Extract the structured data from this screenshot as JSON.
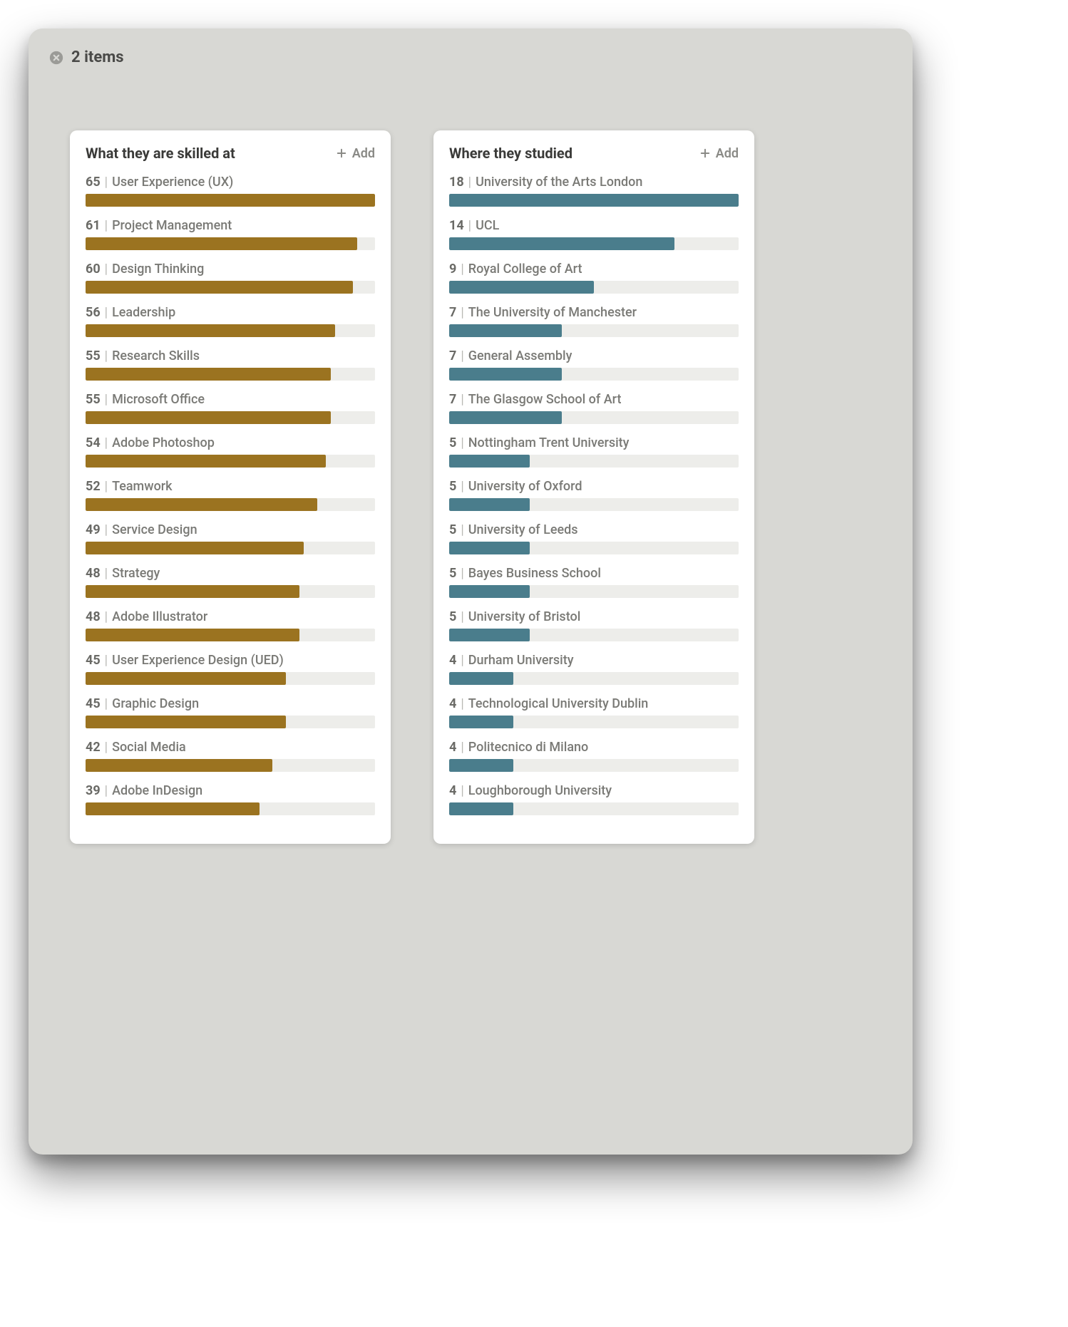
{
  "header": {
    "title": "2 items"
  },
  "buttons": {
    "add_label": "Add"
  },
  "colors": {
    "skills_fill": "#9b7320",
    "studied_fill": "#4a7d8c",
    "track": "#ededea"
  },
  "cards": [
    {
      "id": "skills",
      "title": "What they are skilled at",
      "fill_color": "#9b7320",
      "max_value": 65,
      "items": [
        {
          "value": 65,
          "label": "User Experience (UX)"
        },
        {
          "value": 61,
          "label": "Project Management"
        },
        {
          "value": 60,
          "label": "Design Thinking"
        },
        {
          "value": 56,
          "label": "Leadership"
        },
        {
          "value": 55,
          "label": "Research Skills"
        },
        {
          "value": 55,
          "label": "Microsoft Office"
        },
        {
          "value": 54,
          "label": "Adobe Photoshop"
        },
        {
          "value": 52,
          "label": "Teamwork"
        },
        {
          "value": 49,
          "label": "Service Design"
        },
        {
          "value": 48,
          "label": "Strategy"
        },
        {
          "value": 48,
          "label": "Adobe Illustrator"
        },
        {
          "value": 45,
          "label": "User Experience Design (UED)"
        },
        {
          "value": 45,
          "label": "Graphic Design"
        },
        {
          "value": 42,
          "label": "Social Media"
        },
        {
          "value": 39,
          "label": "Adobe InDesign"
        }
      ]
    },
    {
      "id": "studied",
      "title": "Where they studied",
      "fill_color": "#4a7d8c",
      "max_value": 18,
      "items": [
        {
          "value": 18,
          "label": "University of the Arts London"
        },
        {
          "value": 14,
          "label": "UCL"
        },
        {
          "value": 9,
          "label": "Royal College of Art"
        },
        {
          "value": 7,
          "label": "The University of Manchester"
        },
        {
          "value": 7,
          "label": "General Assembly"
        },
        {
          "value": 7,
          "label": "The Glasgow School of Art"
        },
        {
          "value": 5,
          "label": "Nottingham Trent University"
        },
        {
          "value": 5,
          "label": "University of Oxford"
        },
        {
          "value": 5,
          "label": "University of Leeds"
        },
        {
          "value": 5,
          "label": "Bayes Business School"
        },
        {
          "value": 5,
          "label": "University of Bristol"
        },
        {
          "value": 4,
          "label": "Durham University"
        },
        {
          "value": 4,
          "label": "Technological University Dublin"
        },
        {
          "value": 4,
          "label": "Politecnico di Milano"
        },
        {
          "value": 4,
          "label": "Loughborough University"
        }
      ]
    }
  ],
  "chart_data": [
    {
      "type": "bar",
      "title": "What they are skilled at",
      "orientation": "horizontal",
      "xlabel": "",
      "ylabel": "",
      "xlim": [
        0,
        65
      ],
      "categories": [
        "User Experience (UX)",
        "Project Management",
        "Design Thinking",
        "Leadership",
        "Research Skills",
        "Microsoft Office",
        "Adobe Photoshop",
        "Teamwork",
        "Service Design",
        "Strategy",
        "Adobe Illustrator",
        "User Experience Design (UED)",
        "Graphic Design",
        "Social Media",
        "Adobe InDesign"
      ],
      "values": [
        65,
        61,
        60,
        56,
        55,
        55,
        54,
        52,
        49,
        48,
        48,
        45,
        45,
        42,
        39
      ],
      "color": "#9b7320"
    },
    {
      "type": "bar",
      "title": "Where they studied",
      "orientation": "horizontal",
      "xlabel": "",
      "ylabel": "",
      "xlim": [
        0,
        18
      ],
      "categories": [
        "University of the Arts London",
        "UCL",
        "Royal College of Art",
        "The University of Manchester",
        "General Assembly",
        "The Glasgow School of Art",
        "Nottingham Trent University",
        "University of Oxford",
        "University of Leeds",
        "Bayes Business School",
        "University of Bristol",
        "Durham University",
        "Technological University Dublin",
        "Politecnico di Milano",
        "Loughborough University"
      ],
      "values": [
        18,
        14,
        9,
        7,
        7,
        7,
        5,
        5,
        5,
        5,
        5,
        4,
        4,
        4,
        4
      ],
      "color": "#4a7d8c"
    }
  ]
}
